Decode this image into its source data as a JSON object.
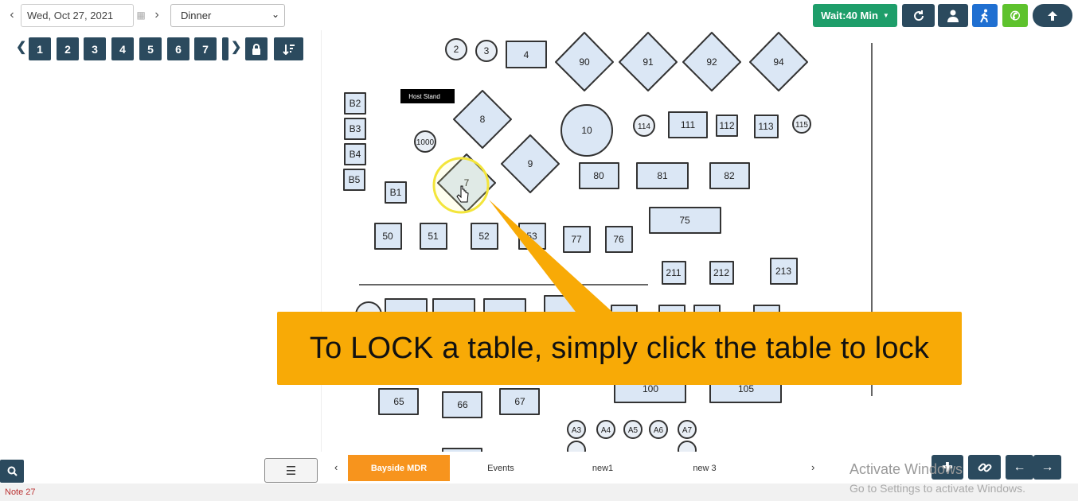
{
  "topbar": {
    "date": "Wed, Oct 27, 2021",
    "meal": "Dinner",
    "wait_label": "Wait:40 Min"
  },
  "num_buttons": [
    "1",
    "2",
    "3",
    "4",
    "5",
    "6",
    "7"
  ],
  "floor": {
    "host_stand": "Host Stand",
    "tables": [
      "2",
      "3",
      "4",
      "90",
      "91",
      "92",
      "94",
      "B2",
      "B3",
      "B4",
      "B5",
      "B1",
      "8",
      "1000",
      "7",
      "9",
      "10",
      "114",
      "111",
      "112",
      "113",
      "115",
      "80",
      "81",
      "82",
      "75",
      "50",
      "51",
      "52",
      "53",
      "77",
      "76",
      "211",
      "212",
      "213",
      "100",
      "105",
      "65",
      "66",
      "67",
      "A3",
      "A4",
      "A5",
      "A6",
      "A7"
    ]
  },
  "callout": "To LOCK a table, simply click the table to lock",
  "tabs": [
    "Bayside MDR",
    "Events",
    "new1",
    "new 3"
  ],
  "note": "Note 27",
  "watermark": {
    "line1": "Activate Windows",
    "line2": "Go to Settings to activate Windows."
  },
  "colors": {
    "accent_dark": "#2b4a5e",
    "wait_green": "#1e9e6a",
    "callout_orange": "#f8aa06",
    "tab_active": "#f7941d",
    "table_fill": "#dbe7f5"
  }
}
